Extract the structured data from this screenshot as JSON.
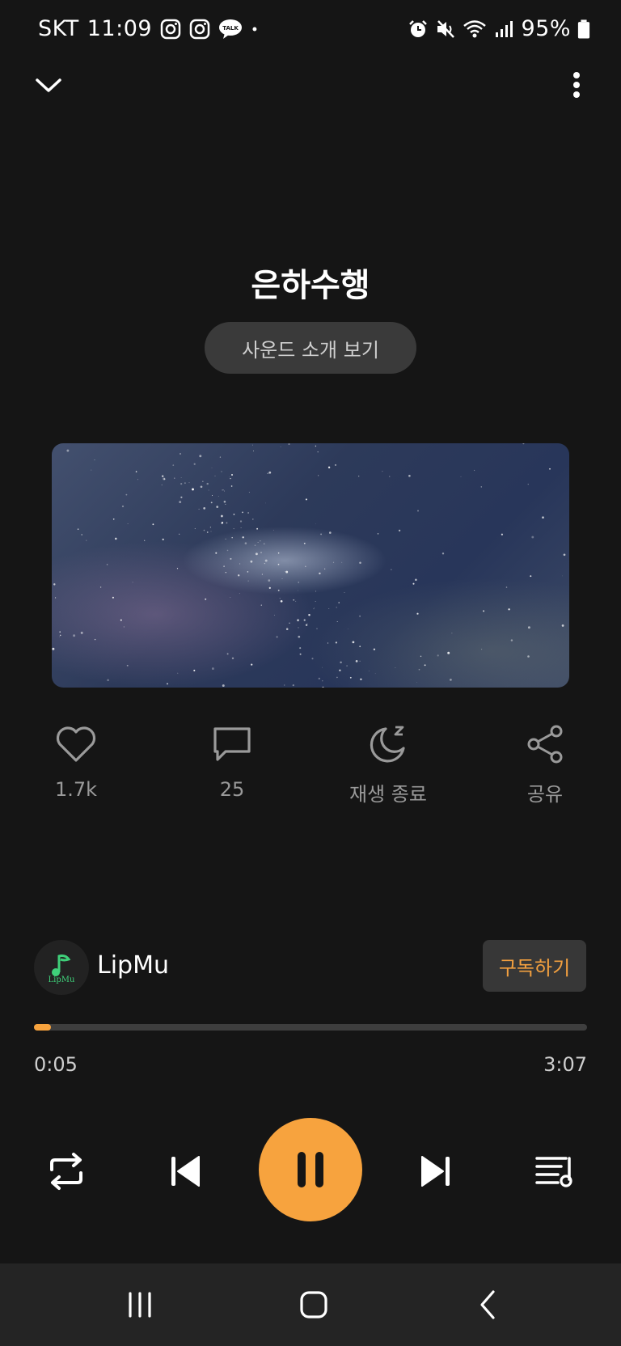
{
  "status_bar": {
    "carrier": "SKT",
    "time": "11:09",
    "battery": "95%",
    "left_icons": [
      "instagram-icon",
      "instagram-icon",
      "kakaotalk-icon",
      "dot-icon"
    ],
    "right_icons": [
      "alarm-icon",
      "mute-icon",
      "wifi-icon",
      "signal-icon",
      "battery-icon"
    ],
    "kakao_label": "TALK"
  },
  "player": {
    "title": "은하수행",
    "intro_button": "사운드 소개 보기",
    "cover_icon": "milky-way-image"
  },
  "actions": [
    {
      "icon": "heart-icon",
      "label": "1.7k"
    },
    {
      "icon": "comment-icon",
      "label": "25"
    },
    {
      "icon": "sleep-timer-icon",
      "label": "재생 종료"
    },
    {
      "icon": "share-icon",
      "label": "공유"
    }
  ],
  "channel": {
    "name": "LipMu",
    "avatar_text": "LipMu",
    "subscribe_label": "구독하기"
  },
  "progress": {
    "current": "0:05",
    "total": "3:07",
    "fraction": 0.03
  },
  "controls": [
    "repeat-icon",
    "previous-icon",
    "pause-icon",
    "next-icon",
    "playlist-icon"
  ],
  "colors": {
    "accent": "#f7a33e",
    "background": "#151515",
    "pill": "#3a3a3a",
    "navbar": "#242424"
  }
}
